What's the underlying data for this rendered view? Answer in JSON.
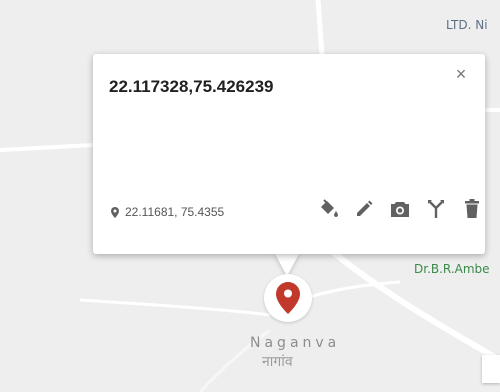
{
  "map": {
    "labels": {
      "top_right": "LTD. Ni",
      "road": "Dr.B.R.Ambe",
      "town": "Naganva",
      "town_local": "नागांव"
    }
  },
  "popup": {
    "title": "22.117328,75.426239",
    "close_label": "×",
    "location_text": "22.11681, 75.4355",
    "actions": [
      {
        "icon": "paint-bucket-icon"
      },
      {
        "icon": "pencil-icon"
      },
      {
        "icon": "camera-icon"
      },
      {
        "icon": "route-icon"
      },
      {
        "icon": "trash-icon"
      }
    ]
  },
  "colors": {
    "map_background": "#eeeeee",
    "road": "#ffffff",
    "marker": "#c0392b",
    "road_label": "#3a8a4a",
    "icon": "#616161"
  }
}
